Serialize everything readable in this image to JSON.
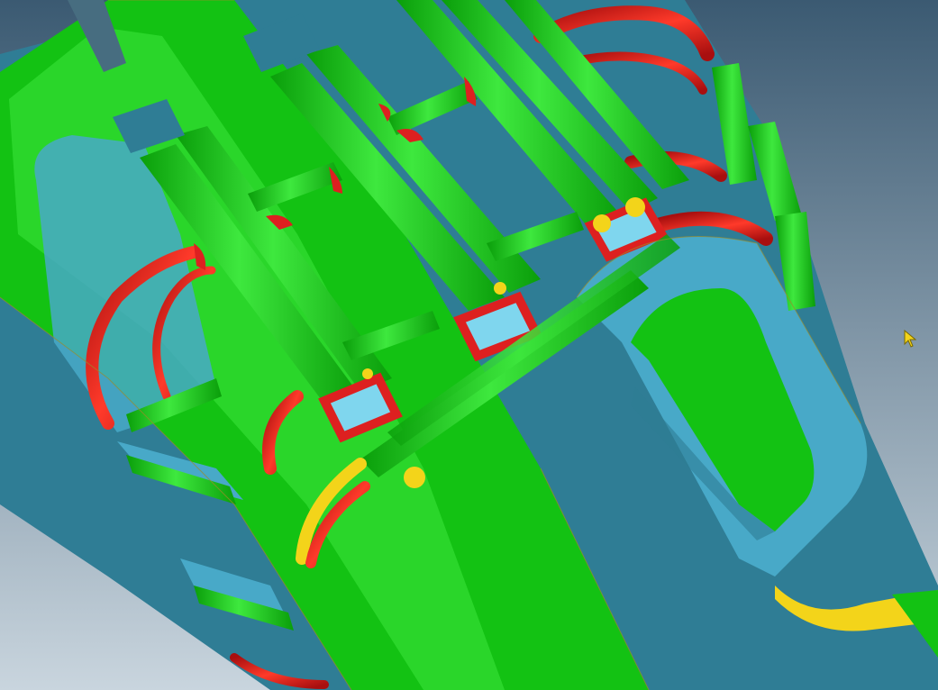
{
  "viewport": {
    "background_top": "#3b5a72",
    "background_bottom": "#c9d5de"
  },
  "colors": {
    "surface_green": "#13c213",
    "surface_green_light": "#3ee83e",
    "surface_green_dark": "#0a9e0a",
    "face_blue": "#48a9c8",
    "face_blue_dark": "#2f7d95",
    "face_blue_light": "#7fd6ee",
    "fillet_red": "#dd2020",
    "fillet_red_dark": "#a80f0f",
    "fillet_yellow": "#f3d41a",
    "edge_line": "#9b8b2a"
  },
  "cursor": {
    "icon": "mouse-pointer-icon",
    "color": "#f3d41a"
  }
}
